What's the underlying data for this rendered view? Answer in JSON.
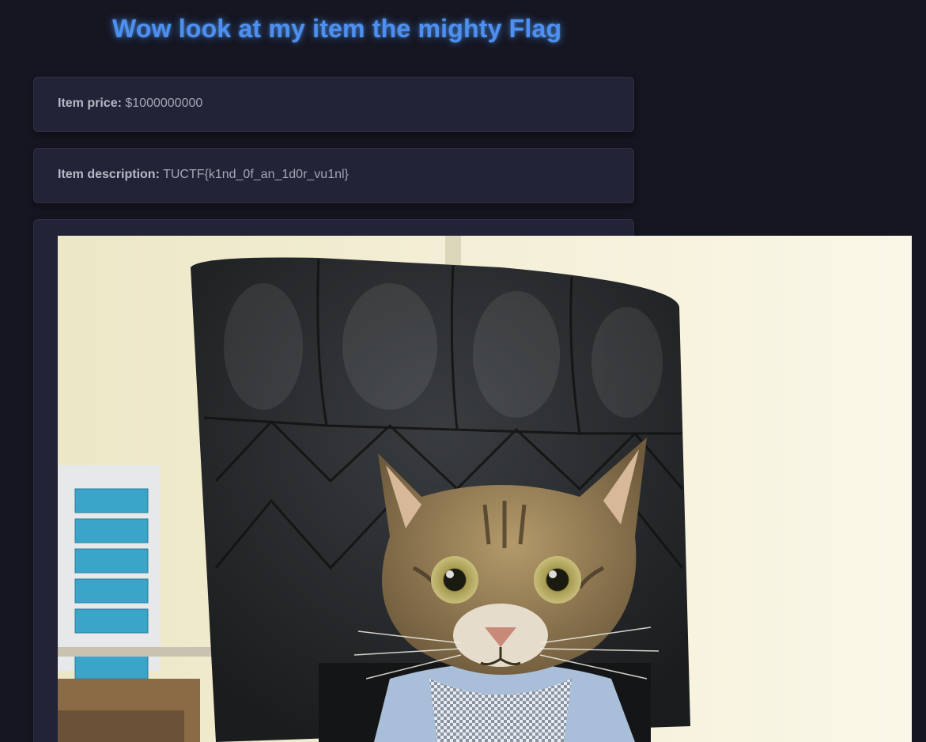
{
  "header": {
    "title": "Wow look at my item the mighty Flag"
  },
  "item": {
    "price_label": "Item price:",
    "price_value": "$1000000000",
    "description_label": "Item description:",
    "description_value": "TUCTF{k1nd_0f_an_1d0r_vu1nl}"
  },
  "image": {
    "alt": "Cat wearing a shirt sitting in a black leather office chair"
  },
  "colors": {
    "background": "#161622",
    "card": "#222336",
    "title": "#4f8ff0",
    "text": "#a4a6b4"
  }
}
